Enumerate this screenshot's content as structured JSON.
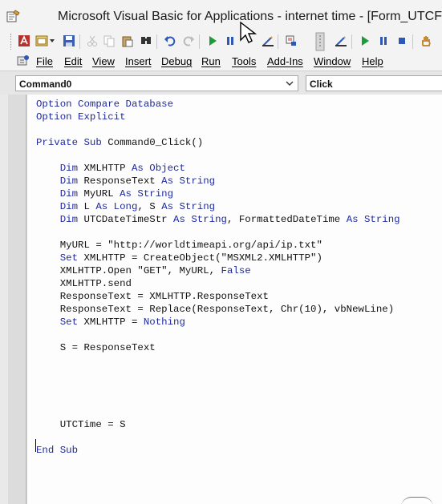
{
  "window": {
    "title": "Microsoft Visual Basic for Applications - internet time - [Form_UTCForm"
  },
  "toolbar": {
    "buttons": [
      "access-icon",
      "insert-userform-icon",
      "save-icon",
      "cut-icon",
      "copy-icon",
      "paste-icon",
      "find-icon",
      "undo-icon",
      "redo-icon",
      "run-icon",
      "break-icon",
      "design-mode-icon",
      "project-explorer-icon",
      "toolbar-grip",
      "design-mode-icon-2",
      "run-icon-2",
      "break-icon-2",
      "reset-icon",
      "hand-icon"
    ]
  },
  "menu": {
    "items": [
      "File",
      "Edit",
      "View",
      "Insert",
      "Debug",
      "Run",
      "Tools",
      "Add-Ins",
      "Window",
      "Help"
    ]
  },
  "object_combo": {
    "value": "Command0"
  },
  "procedure_combo": {
    "value": "Click"
  },
  "code": {
    "lines": [
      [
        {
          "k": 1,
          "t": "Option Compare Database"
        }
      ],
      [
        {
          "k": 1,
          "t": "Option Explicit"
        }
      ],
      [],
      [
        {
          "k": 1,
          "t": "Private Sub "
        },
        {
          "k": 0,
          "t": "Command0_Click()"
        }
      ],
      [],
      [
        {
          "k": 0,
          "t": "    "
        },
        {
          "k": 1,
          "t": "Dim "
        },
        {
          "k": 0,
          "t": "XMLHTTP "
        },
        {
          "k": 1,
          "t": "As Object"
        }
      ],
      [
        {
          "k": 0,
          "t": "    "
        },
        {
          "k": 1,
          "t": "Dim "
        },
        {
          "k": 0,
          "t": "ResponseText "
        },
        {
          "k": 1,
          "t": "As String"
        }
      ],
      [
        {
          "k": 0,
          "t": "    "
        },
        {
          "k": 1,
          "t": "Dim "
        },
        {
          "k": 0,
          "t": "MyURL "
        },
        {
          "k": 1,
          "t": "As String"
        }
      ],
      [
        {
          "k": 0,
          "t": "    "
        },
        {
          "k": 1,
          "t": "Dim "
        },
        {
          "k": 0,
          "t": "L "
        },
        {
          "k": 1,
          "t": "As Long"
        },
        {
          "k": 0,
          "t": ", S "
        },
        {
          "k": 1,
          "t": "As String"
        }
      ],
      [
        {
          "k": 0,
          "t": "    "
        },
        {
          "k": 1,
          "t": "Dim "
        },
        {
          "k": 0,
          "t": "UTCDateTimeStr "
        },
        {
          "k": 1,
          "t": "As String"
        },
        {
          "k": 0,
          "t": ", FormattedDateTime "
        },
        {
          "k": 1,
          "t": "As String"
        }
      ],
      [],
      [
        {
          "k": 0,
          "t": "    MyURL = \"http://worldtimeapi.org/api/ip.txt\""
        }
      ],
      [
        {
          "k": 0,
          "t": "    "
        },
        {
          "k": 1,
          "t": "Set "
        },
        {
          "k": 0,
          "t": "XMLHTTP = CreateObject(\"MSXML2.XMLHTTP\")"
        }
      ],
      [
        {
          "k": 0,
          "t": "    XMLHTTP.Open \"GET\", MyURL, "
        },
        {
          "k": 1,
          "t": "False"
        }
      ],
      [
        {
          "k": 0,
          "t": "    XMLHTTP.send"
        }
      ],
      [
        {
          "k": 0,
          "t": "    ResponseText = XMLHTTP.ResponseText"
        }
      ],
      [
        {
          "k": 0,
          "t": "    ResponseText = Replace(ResponseText, Chr(10), vbNewLine)"
        }
      ],
      [
        {
          "k": 0,
          "t": "    "
        },
        {
          "k": 1,
          "t": "Set "
        },
        {
          "k": 0,
          "t": "XMLHTTP = "
        },
        {
          "k": 1,
          "t": "Nothing"
        }
      ],
      [],
      [
        {
          "k": 0,
          "t": "    S = ResponseText"
        }
      ],
      [],
      [],
      [],
      [],
      [],
      [
        {
          "k": 0,
          "t": "    UTCTime = S"
        }
      ],
      [],
      [
        {
          "k": 1,
          "t": "End Sub"
        }
      ]
    ]
  },
  "colors": {
    "keyword": "#1f2b9e",
    "text": "#111111",
    "editor_bg": "#fdfdfd",
    "chrome_bg": "#f3f3f3"
  }
}
